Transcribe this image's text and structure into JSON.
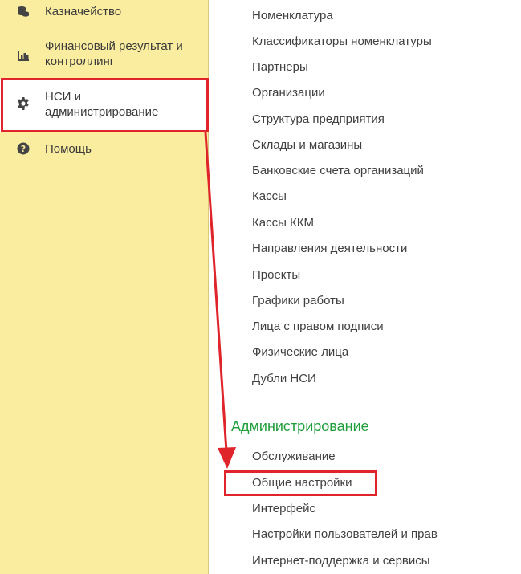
{
  "sidebar": {
    "items": [
      {
        "label": "Казначейство",
        "icon": "coins-icon"
      },
      {
        "label": "Финансовый результат и\nконтроллинг",
        "icon": "bar-chart-icon"
      },
      {
        "label": "НСИ и\nадминистрирование",
        "icon": "gear-icon"
      },
      {
        "label": "Помощь",
        "icon": "help-icon"
      }
    ]
  },
  "nsi": {
    "links": [
      "Номенклатура",
      "Классификаторы номенклатуры",
      "Партнеры",
      "Организации",
      "Структура предприятия",
      "Склады и магазины",
      "Банковские счета организаций",
      "Кассы",
      "Кассы ККМ",
      "Направления деятельности",
      "Проекты",
      "Графики работы",
      "Лица с правом подписи",
      "Физические лица",
      "Дубли НСИ"
    ]
  },
  "admin": {
    "title": "Администрирование",
    "links": [
      "Обслуживание",
      "Общие настройки",
      "Интерфейс",
      "Настройки пользователей и прав",
      "Интернет-поддержка и сервисы"
    ]
  },
  "colors": {
    "sidebar_bg": "#fbeda0",
    "highlight": "#e0242b",
    "section_header": "#1f9e3a",
    "icon": "#444444"
  }
}
